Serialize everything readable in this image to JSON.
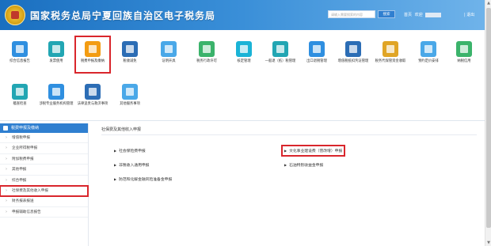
{
  "header": {
    "title": "国家税务总局宁夏回族自治区电子税务局",
    "search_placeholder": "请输入需要搜索的内容",
    "search_button": "搜索",
    "home_link": "首页",
    "welcome": "欢迎",
    "logout": "| 退出"
  },
  "icons": {
    "row1": [
      {
        "label": "综合信息报告",
        "color": "#2f8fe0",
        "icon": "doc-icon"
      },
      {
        "label": "发票使用",
        "color": "#22a6b3",
        "icon": "invoice-icon"
      },
      {
        "label": "税费申报及缴纳",
        "color": "#f39c12",
        "icon": "tax-declare-icon"
      },
      {
        "label": "税收减免",
        "color": "#2c6db5",
        "icon": "grid-icon"
      },
      {
        "label": "证明开具",
        "color": "#4aa8e8",
        "icon": "folder-icon"
      },
      {
        "label": "税务行政许可",
        "color": "#3bb36b",
        "icon": "license-icon"
      },
      {
        "label": "核定管理",
        "color": "#1ab3d6",
        "icon": "tax-icon"
      },
      {
        "label": "一般退（抵）税管理",
        "color": "#22a6b3",
        "icon": "refund-icon"
      },
      {
        "label": "出口退税管理",
        "color": "#2f8fe0",
        "icon": "export-icon"
      },
      {
        "label": "增值税抵扣凭证管理",
        "color": "#2c6db5",
        "icon": "voucher-icon"
      },
      {
        "label": "税务代保管资金收取",
        "color": "#e0a526",
        "icon": "fund-icon"
      },
      {
        "label": "预约定价安排",
        "color": "#4aa8e8",
        "icon": "calendar-icon"
      },
      {
        "label": "纳税信用",
        "color": "#3bb36b",
        "icon": "credit-icon"
      }
    ],
    "row2": [
      {
        "label": "稽查检查",
        "color": "#22a6b3",
        "icon": "inspect-icon"
      },
      {
        "label": "涉税专业服务机构管理",
        "color": "#2f8fe0",
        "icon": "agency-icon"
      },
      {
        "label": "法律追责与救济事项",
        "color": "#2c6db5",
        "icon": "law-icon"
      },
      {
        "label": "其他服务事项",
        "color": "#4aa8e8",
        "icon": "service-icon"
      }
    ]
  },
  "sidebar": {
    "title": "税费申报及缴纳",
    "items": [
      "增值税申报",
      "企业所得税申报",
      "附加税费申报",
      "其他申报",
      "综合申报",
      "社保费及其他收入申报",
      "财务报表报送",
      "申报辅助信息报告"
    ],
    "active_index": 5
  },
  "main": {
    "title": "社保费及其他收入申报",
    "links_left": [
      "社会保险费申报",
      "非税收入通用申报",
      "防范和化解金融风险准备金申报"
    ],
    "links_right": [
      "文化事业建设费（营改增）申报",
      "石油特别收益金申报"
    ]
  }
}
